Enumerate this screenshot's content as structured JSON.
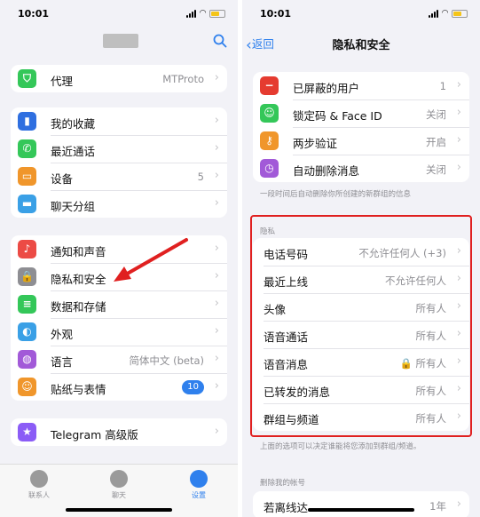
{
  "status": {
    "time_left": "10:01",
    "time_right": "10:01"
  },
  "left": {
    "proxy": {
      "label": "代理",
      "value": "MTProto"
    },
    "group2": [
      {
        "label": "我的收藏",
        "value": "",
        "icon": "bookmark-icon",
        "color": "#2f6fe0"
      },
      {
        "label": "最近通话",
        "value": "",
        "icon": "phone-icon",
        "color": "#34c759"
      },
      {
        "label": "设备",
        "value": "5",
        "icon": "devices-icon",
        "color": "#f0962b"
      },
      {
        "label": "聊天分组",
        "value": "",
        "icon": "folder-icon",
        "color": "#3aa0e6"
      }
    ],
    "group3": [
      {
        "label": "通知和声音",
        "value": "",
        "icon": "bell-icon",
        "color": "#ec4b45"
      },
      {
        "label": "隐私和安全",
        "value": "",
        "icon": "lock-icon",
        "color": "#8e8e93"
      },
      {
        "label": "数据和存储",
        "value": "",
        "icon": "storage-icon",
        "color": "#34c759"
      },
      {
        "label": "外观",
        "value": "",
        "icon": "appearance-icon",
        "color": "#3aa0e6"
      },
      {
        "label": "语言",
        "value": "简体中文 (beta)",
        "icon": "globe-icon",
        "color": "#a25ad8"
      },
      {
        "label": "贴纸与表情",
        "badge": "10",
        "icon": "sticker-icon",
        "color": "#f0962b"
      }
    ],
    "premium": {
      "label": "Telegram 高级版"
    },
    "tabs": [
      "联系人",
      "聊天",
      "设置"
    ]
  },
  "right": {
    "back": "返回",
    "title": "隐私和安全",
    "security": [
      {
        "label": "已屏蔽的用户",
        "value": "1",
        "icon": "block-icon",
        "color": "#e53b30"
      },
      {
        "label": "锁定码 & Face ID",
        "value": "关闭",
        "icon": "faceid-icon",
        "color": "#34c759"
      },
      {
        "label": "两步验证",
        "value": "开启",
        "icon": "key-icon",
        "color": "#f0962b"
      },
      {
        "label": "自动删除消息",
        "value": "关闭",
        "icon": "timer-icon",
        "color": "#a25ad8"
      }
    ],
    "security_note": "一段时间后自动删除你所创建的新群组的信息",
    "privacy_header": "隐私",
    "privacy": [
      {
        "label": "电话号码",
        "value": "不允许任何人 (+3)"
      },
      {
        "label": "最近上线",
        "value": "不允许任何人"
      },
      {
        "label": "头像",
        "value": "所有人"
      },
      {
        "label": "语音通话",
        "value": "所有人"
      },
      {
        "label": "语音消息",
        "value": "🔒 所有人"
      },
      {
        "label": "已转发的消息",
        "value": "所有人"
      },
      {
        "label": "群组与频道",
        "value": "所有人"
      }
    ],
    "privacy_note": "上面的选项可以决定谁能将您添加到群组/频道。",
    "delete_header": "删除我的帐号",
    "delete_row": {
      "label": "若离线达",
      "value": "1年"
    }
  },
  "colors": {
    "accent": "#2f80ed",
    "highlight": "#e02020"
  }
}
